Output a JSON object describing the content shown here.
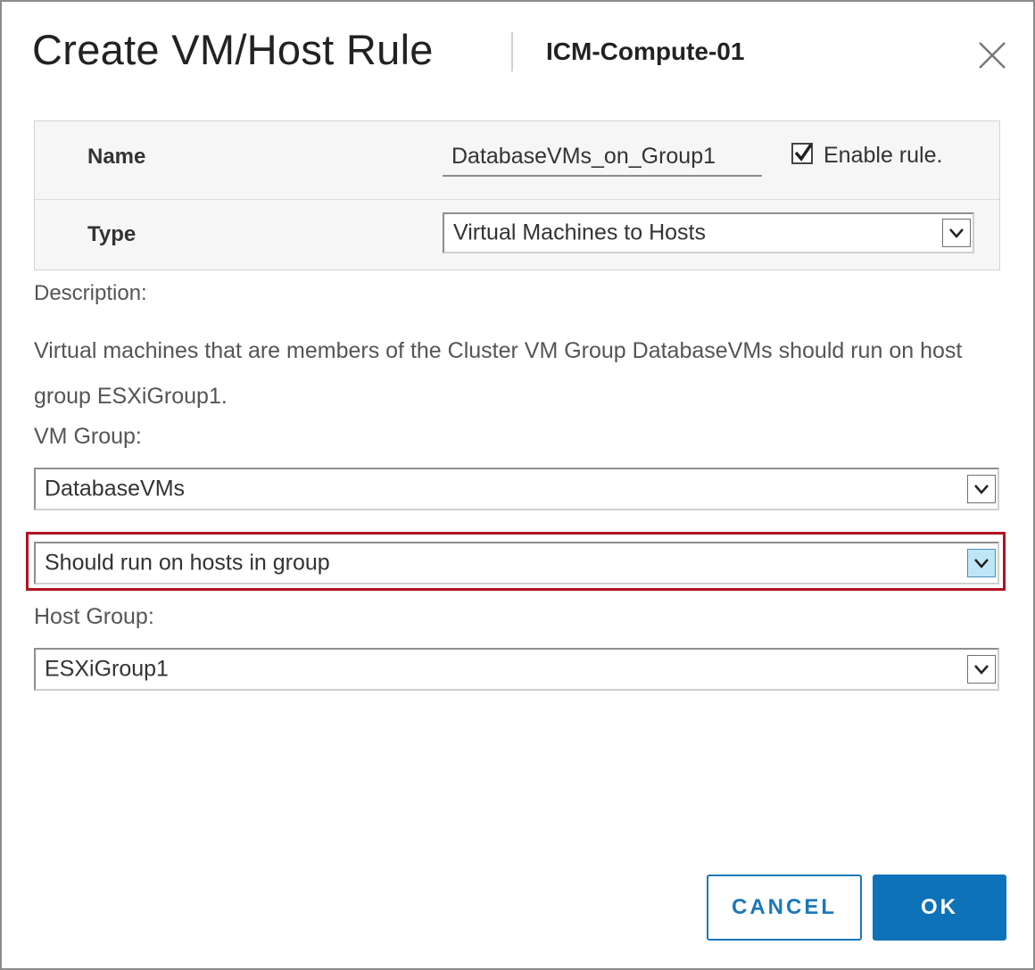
{
  "dialog": {
    "title": "Create VM/Host Rule",
    "subtitle": "ICM-Compute-01",
    "close_icon": "close-icon"
  },
  "form": {
    "name_label": "Name",
    "name_value": "DatabaseVMs_on_Group1",
    "enable_checked": true,
    "enable_label": "Enable rule.",
    "type_label": "Type",
    "type_value": "Virtual Machines to Hosts"
  },
  "description": {
    "label": "Description:",
    "text": "Virtual machines that are members of the Cluster VM Group DatabaseVMs should run on host group ESXiGroup1."
  },
  "vm_group": {
    "label": "VM Group:",
    "value": "DatabaseVMs"
  },
  "rule_condition": {
    "value": "Should run on hosts in group",
    "highlight_color": "#b1121f"
  },
  "host_group": {
    "label": "Host Group:",
    "value": "ESXiGroup1"
  },
  "buttons": {
    "cancel": "CANCEL",
    "ok": "OK"
  },
  "colors": {
    "primary": "#0e72b9",
    "highlight": "#b1121f",
    "active_dropdown": "#bfe6f7"
  }
}
